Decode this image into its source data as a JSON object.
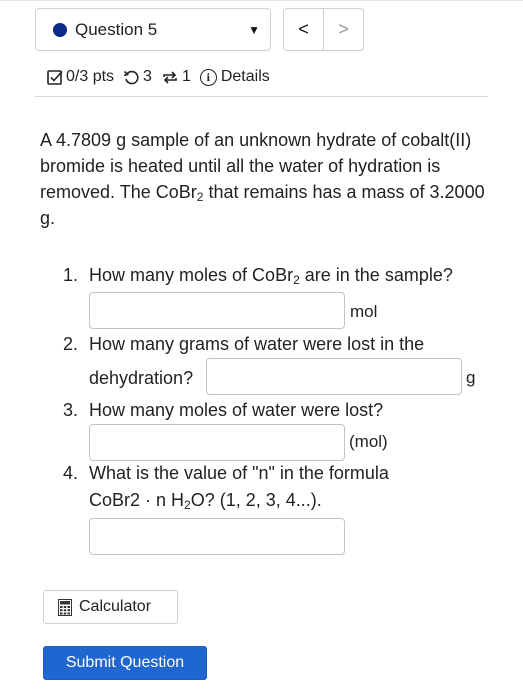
{
  "header": {
    "question_select_label": "Question 5",
    "status_dot_color": "#0b2a8a",
    "prev_symbol": "<",
    "next_symbol": ">"
  },
  "meta": {
    "score": "0/3 pts",
    "retries": "3",
    "attempts": "1",
    "details": "Details"
  },
  "problem": {
    "text_before_formula": "A 4.7809 g sample of an unknown hydrate of cobalt(II) bromide is heated until all the water of hydration is removed. The CoBr",
    "formula_sub": "2",
    "text_after_formula": " that remains has a mass of 3.2000 g."
  },
  "questions": [
    {
      "num": "1.",
      "before": "How many moles of CoBr",
      "sub": "2",
      "after": " are in the sample?",
      "unit": "mol",
      "value": ""
    },
    {
      "num": "2.",
      "line1": "How many grams of water were lost in the",
      "line2": "dehydration?",
      "unit": "g",
      "value": ""
    },
    {
      "num": "3.",
      "text": "How many moles of water were lost?",
      "unit": "(mol)",
      "value": ""
    },
    {
      "num": "4.",
      "line1": "What is the value of \"n\" in the formula",
      "line2_before": "CoBr2 · n H",
      "line2_sub": "2",
      "line2_after": "O? (1, 2, 3, 4...).",
      "value": ""
    }
  ],
  "buttons": {
    "calculator": "Calculator",
    "submit": "Submit Question",
    "submit_color": "#1f66d0"
  }
}
